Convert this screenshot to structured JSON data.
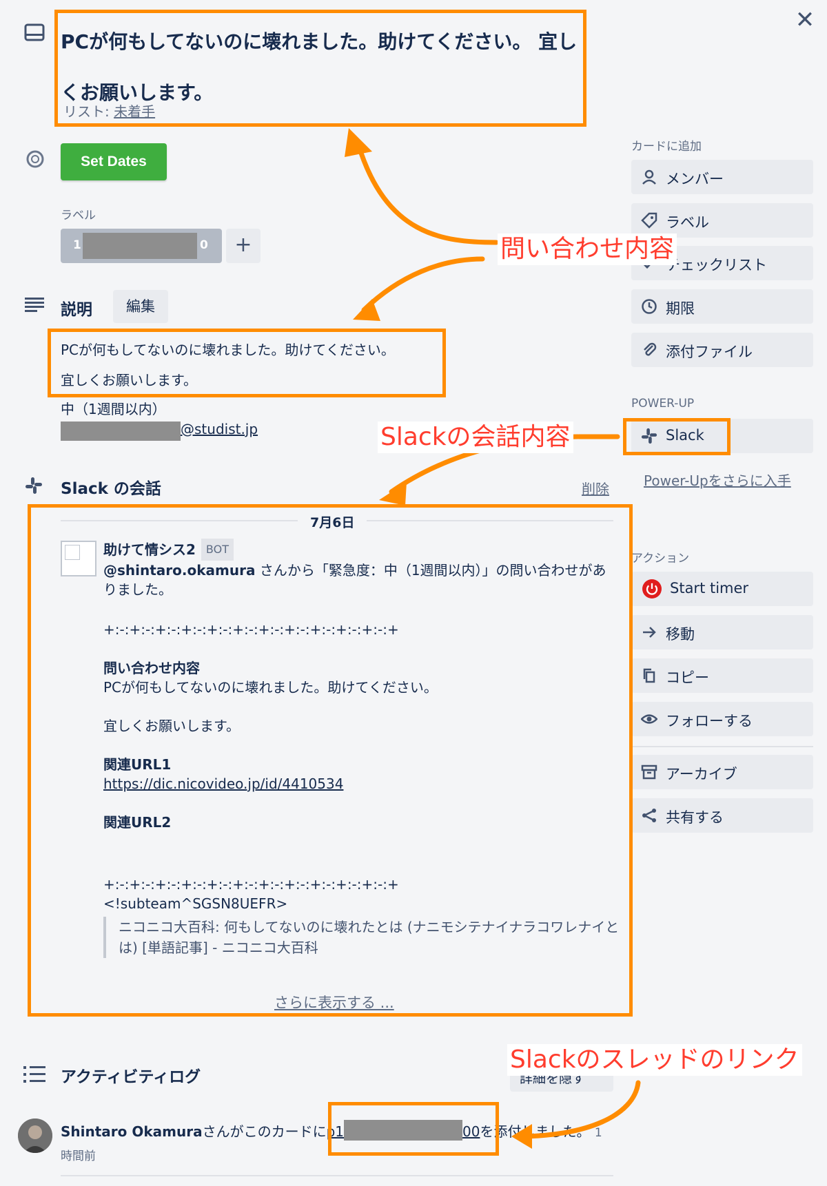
{
  "card": {
    "title": "PCが何もしてないのに壊れました。助けてください。 宜しくお願いします。",
    "list_prefix": "リスト: ",
    "list_name": "未着手"
  },
  "dates": {
    "button_label": "Set Dates"
  },
  "labels": {
    "heading": "ラベル",
    "chip_left": "1",
    "chip_right": "0",
    "add_label": "+"
  },
  "description": {
    "heading": "説明",
    "edit_label": "編集",
    "line1": "PCが何もしてないのに壊れました。助けてください。",
    "line2": "宜しくお願いします。",
    "priority": "中（1週間以内）",
    "email_suffix": "@studist.jp"
  },
  "slack": {
    "heading": "Slack の会話",
    "delete_label": "削除",
    "date": "7月6日",
    "bot_name": "助けて情シス2",
    "bot_badge": "BOT",
    "mention": "@shintaro.okamura",
    "intro": " さんから「緊急度：中（1週間以内）」の問い合わせがありました。",
    "separator": "+:-:+:-:+:-:+:-:+:-:+:-:+:-:+:-:+:-:+:-:+:-:+",
    "q_heading": "問い合わせ内容",
    "q_line1": "PCが何もしてないのに壊れました。助けてください。",
    "q_line2": "宜しくお願いします。",
    "url1_heading": "関連URL1",
    "url1": "https://dic.nicovideo.jp/id/4410534",
    "url2_heading": "関連URL2",
    "subteam": "<!subteam^SGSN8UEFR>",
    "quote": "ニコニコ大百科: 何もしてないのに壊れたとは (ナニモシテナイナラコワレナイとは) [単語記事] - ニコニコ大百科",
    "show_more": "さらに表示する ..."
  },
  "sidebar": {
    "add_heading": "カードに追加",
    "add_items": [
      {
        "label": "メンバー",
        "icon": "person-icon"
      },
      {
        "label": "ラベル",
        "icon": "tag-icon"
      },
      {
        "label": "チェックリスト",
        "icon": "checklist-icon"
      },
      {
        "label": "期限",
        "icon": "clock-icon"
      },
      {
        "label": "添付ファイル",
        "icon": "paperclip-icon"
      }
    ],
    "powerup_heading": "POWER-UP",
    "slack_label": "Slack",
    "more_powerups": "Power-Upをさらに入手",
    "actions_heading": "アクション",
    "start_timer": "Start timer",
    "actions": [
      {
        "label": "移動",
        "icon": "arrow-right-icon"
      },
      {
        "label": "コピー",
        "icon": "copy-icon"
      },
      {
        "label": "フォローする",
        "icon": "eye-icon"
      },
      {
        "label": "アーカイブ",
        "icon": "archive-icon"
      },
      {
        "label": "共有する",
        "icon": "share-icon"
      }
    ]
  },
  "activity": {
    "heading": "アクティビティログ",
    "hide_details": "詳細を隠す",
    "user": "Shintaro Okamura",
    "text_before": "さんがこのカードに",
    "link_prefix": "p1",
    "link_suffix": "00",
    "text_after": "を添付しました。",
    "time": "1時間前"
  },
  "annotations": {
    "inquiry": "問い合わせ内容",
    "slack_conversation": "Slackの会話内容",
    "thread_link": "Slackのスレッドのリンク"
  },
  "colors": {
    "accent_orange": "#ff8c00",
    "annotation_red": "#ff3d2e",
    "set_dates_green": "#3fae3f",
    "timer_red": "#e01e1e"
  }
}
